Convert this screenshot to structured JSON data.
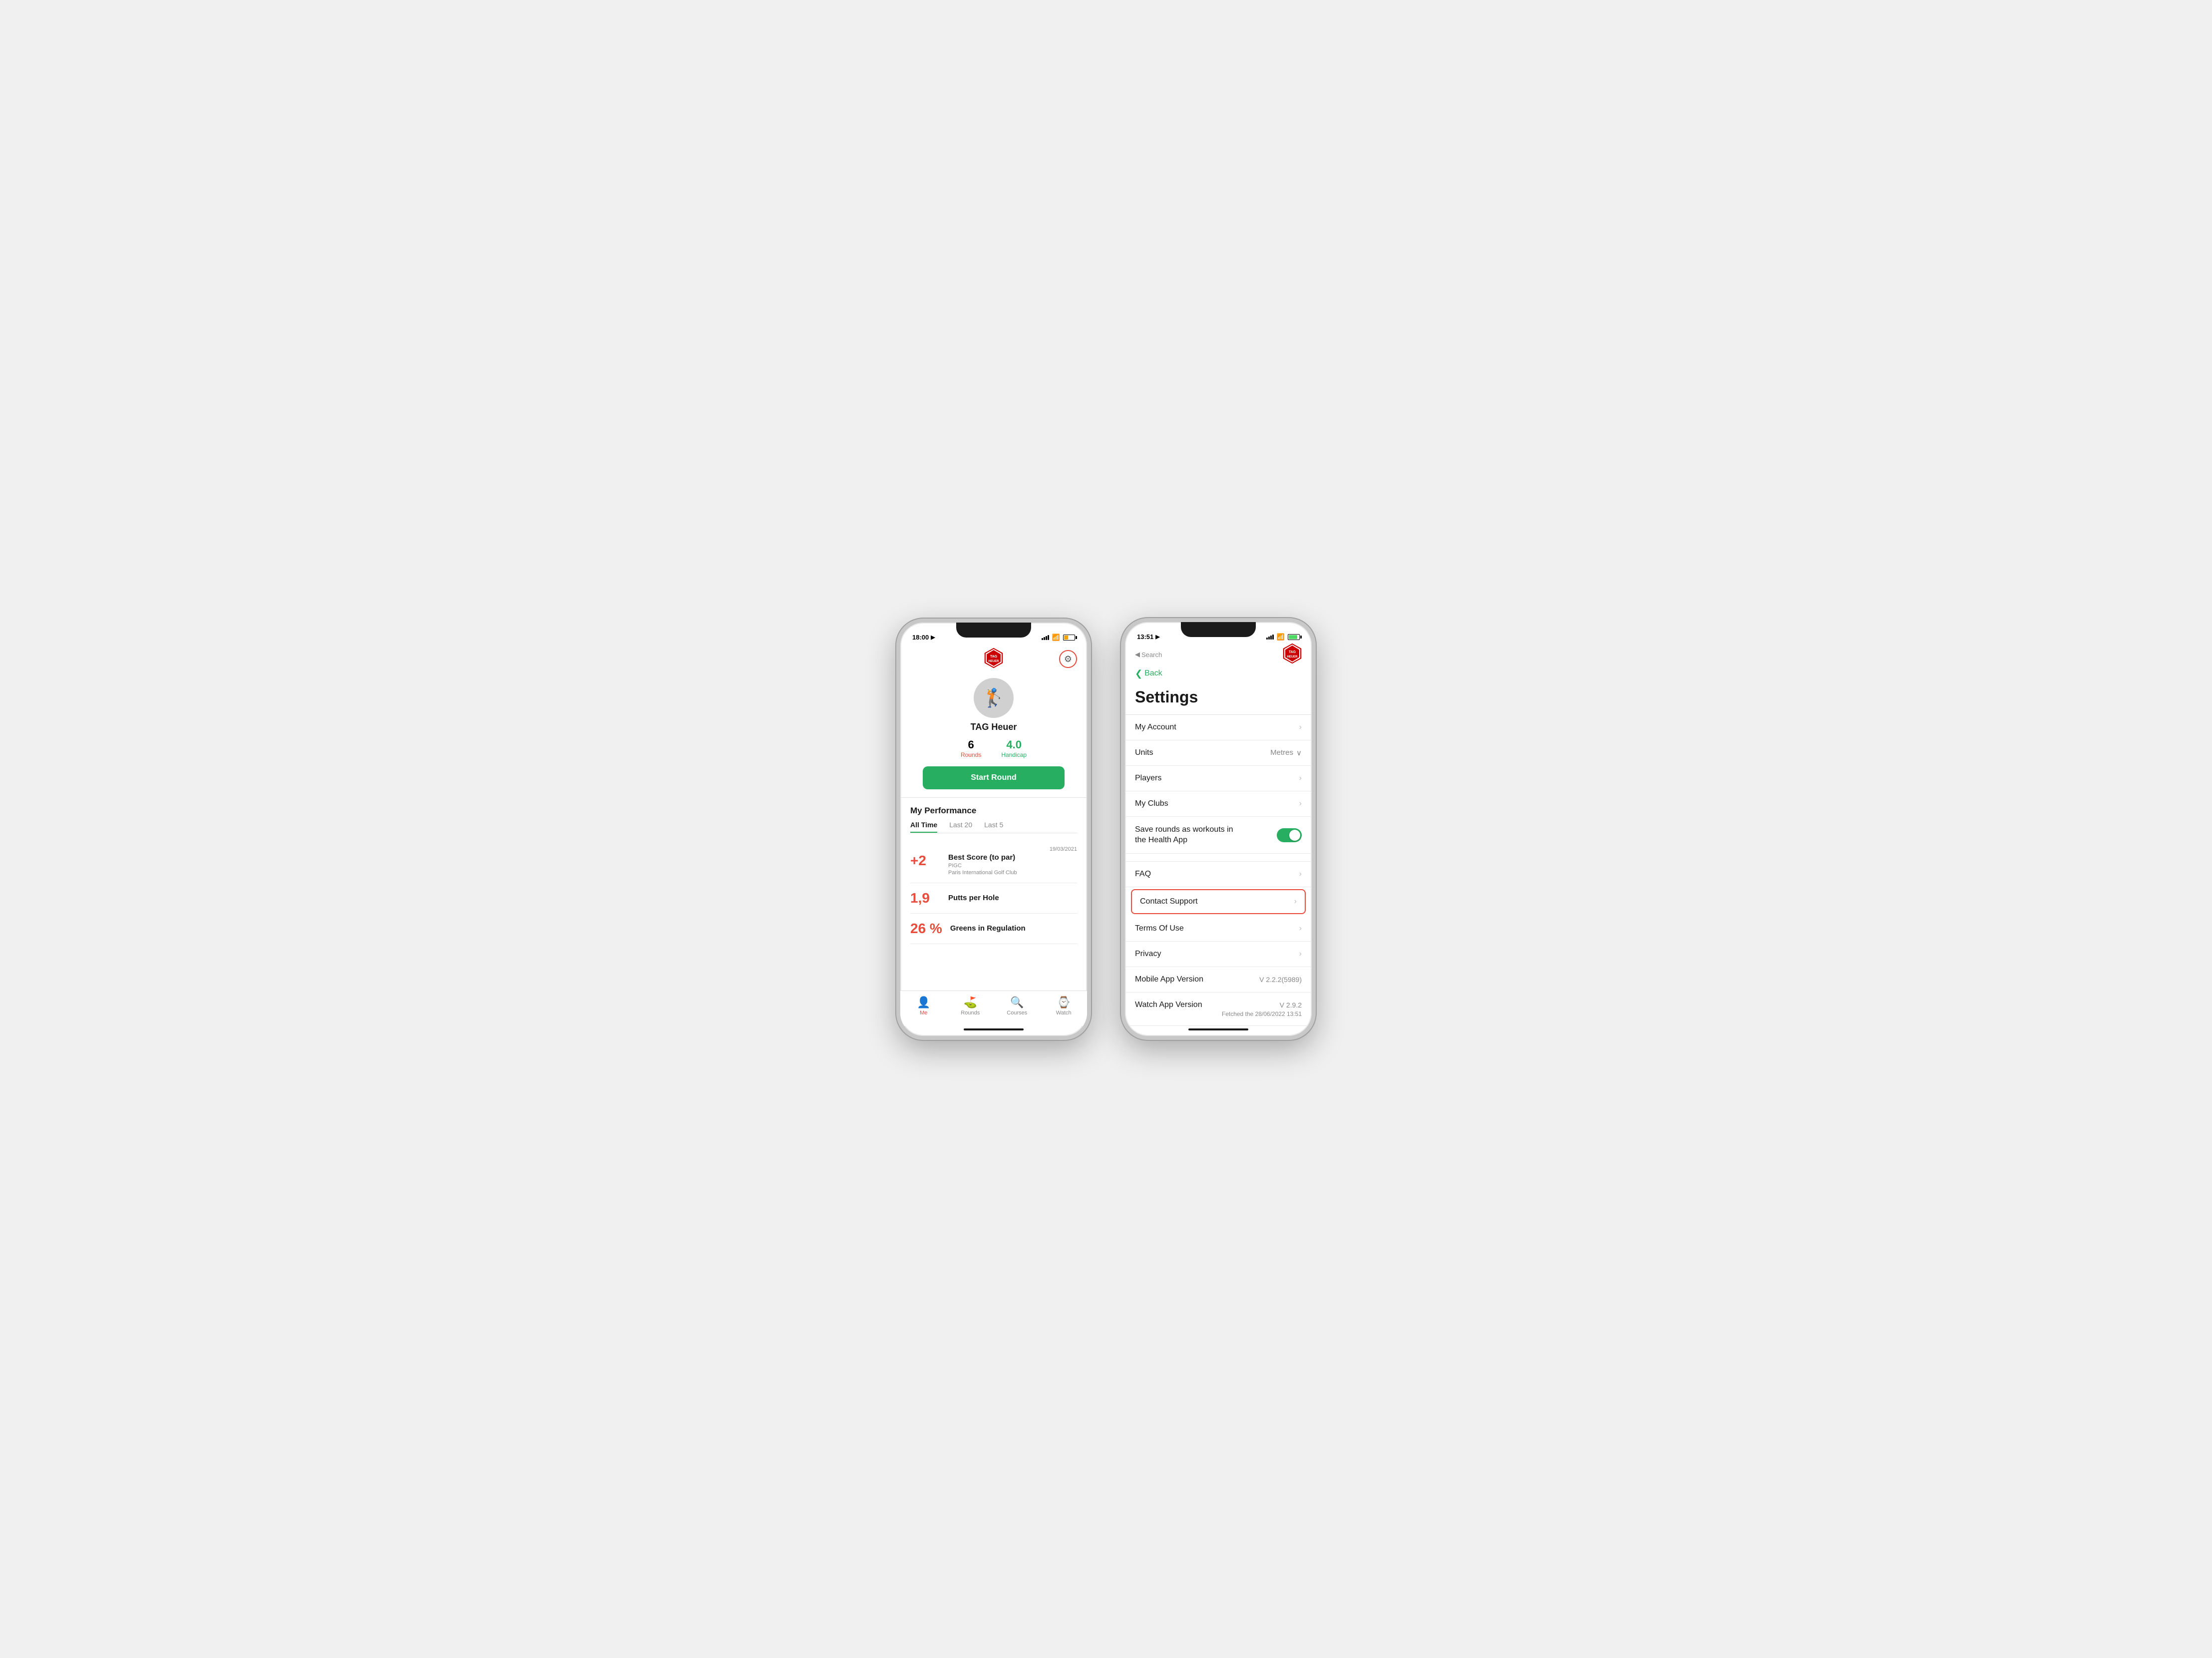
{
  "phone1": {
    "statusBar": {
      "time": "18:00",
      "locationIcon": "▶",
      "batteryLevel": "low"
    },
    "header": {
      "gearLabel": "⚙"
    },
    "profile": {
      "name": "TAG Heuer",
      "roundsLabel": "Rounds",
      "roundsValue": "6",
      "handicapLabel": "Handicap",
      "handicapValue": "4.0",
      "startRoundBtn": "Start Round"
    },
    "performance": {
      "title": "My Performance",
      "tabs": [
        "All Time",
        "Last 20",
        "Last 5"
      ],
      "activeTab": 0,
      "cards": [
        {
          "value": "+2",
          "label": "Best Score (to par)",
          "sublabel1": "PIGC",
          "sublabel2": "Paris International Golf Club",
          "date": "19/03/2021"
        },
        {
          "value": "1,9",
          "label": "Putts per Hole",
          "sublabel1": "",
          "sublabel2": "",
          "date": ""
        },
        {
          "value": "26 %",
          "label": "Greens in Regulation",
          "sublabel1": "",
          "sublabel2": "",
          "date": ""
        }
      ]
    },
    "bottomNav": [
      {
        "icon": "👤",
        "label": "Me",
        "active": true
      },
      {
        "icon": "⛳",
        "label": "Rounds",
        "active": false
      },
      {
        "icon": "🔍",
        "label": "Courses",
        "active": false
      },
      {
        "icon": "⌚",
        "label": "Watch",
        "active": false
      }
    ]
  },
  "phone2": {
    "statusBar": {
      "time": "13:51",
      "locationIcon": "▶",
      "batteryLevel": "full"
    },
    "nav": {
      "searchLabel": "Search",
      "backLabel": "Back"
    },
    "settings": {
      "title": "Settings",
      "items": [
        {
          "label": "My Account",
          "right": "chevron",
          "type": "link"
        },
        {
          "label": "Units",
          "right": "Metres",
          "type": "dropdown"
        },
        {
          "label": "Players",
          "right": "chevron",
          "type": "link"
        },
        {
          "label": "My Clubs",
          "right": "chevron",
          "type": "link"
        },
        {
          "label": "Save rounds as workouts in the Health App",
          "right": "toggle",
          "type": "toggle",
          "toggled": true
        },
        {
          "label": "FAQ",
          "right": "chevron",
          "type": "link"
        },
        {
          "label": "Contact Support",
          "right": "chevron",
          "type": "link",
          "highlighted": true
        },
        {
          "label": "Terms Of Use",
          "right": "chevron",
          "type": "link"
        },
        {
          "label": "Privacy",
          "right": "chevron",
          "type": "link"
        },
        {
          "label": "Mobile App Version",
          "right": "V 2.2.2(5989)",
          "type": "info"
        },
        {
          "label": "Watch App Version",
          "right": "V 2.9.2",
          "sublabel": "Fetched the 28/06/2022 13:51",
          "type": "version"
        }
      ]
    }
  }
}
